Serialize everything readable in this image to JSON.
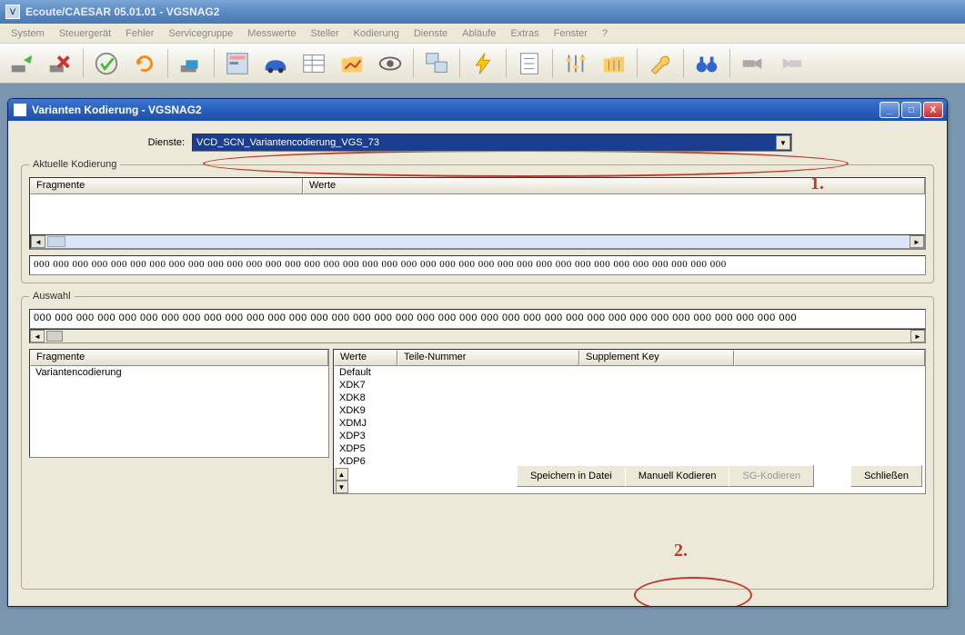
{
  "app": {
    "title": "Ecoute/CAESAR 05.01.01 - VGSNAG2",
    "icon_letter": "V"
  },
  "menu": [
    "System",
    "Steuergerät",
    "Fehler",
    "Servicegruppe",
    "Messwerte",
    "Steller",
    "Kodierung",
    "Dienste",
    "Abläufe",
    "Extras",
    "Fenster",
    "?"
  ],
  "child": {
    "title": "Varianten Kodierung - VGSNAG2",
    "dienste_label": "Dienste:",
    "dienste_value": "VCD_SCN_Variantencodierung_VGS_73",
    "aktuelle_legend": "Aktuelle Kodierung",
    "auswahl_legend": "Auswahl",
    "cols_ak": {
      "fragmente": "Fragmente",
      "werte": "Werte"
    },
    "cols_aus_left": {
      "fragmente": "Fragmente"
    },
    "cols_aus_right": {
      "werte": "Werte",
      "teile": "Teile-Nummer",
      "supp": "Supplement Key"
    },
    "hex": "000 000 000 000 000 000 000 000 000 000 000 000 000 000 000 000 000 000 000 000 000 000 000 000 000 000 000 000 000 000 000 000 000 000 000 000",
    "aus_left_rows": [
      "Variantencodierung"
    ],
    "aus_right_rows": [
      "Default",
      "XDK7",
      "XDK8",
      "XDK9",
      "XDMJ",
      "XDP3",
      "XDP5",
      "XDP6"
    ],
    "buttons": {
      "speichern": "Speichern in Datei",
      "manuell": "Manuell Kodieren",
      "sg": "SG-Kodieren",
      "schliessen": "Schließen"
    }
  },
  "annotations": {
    "one": "1.",
    "two": "2."
  }
}
